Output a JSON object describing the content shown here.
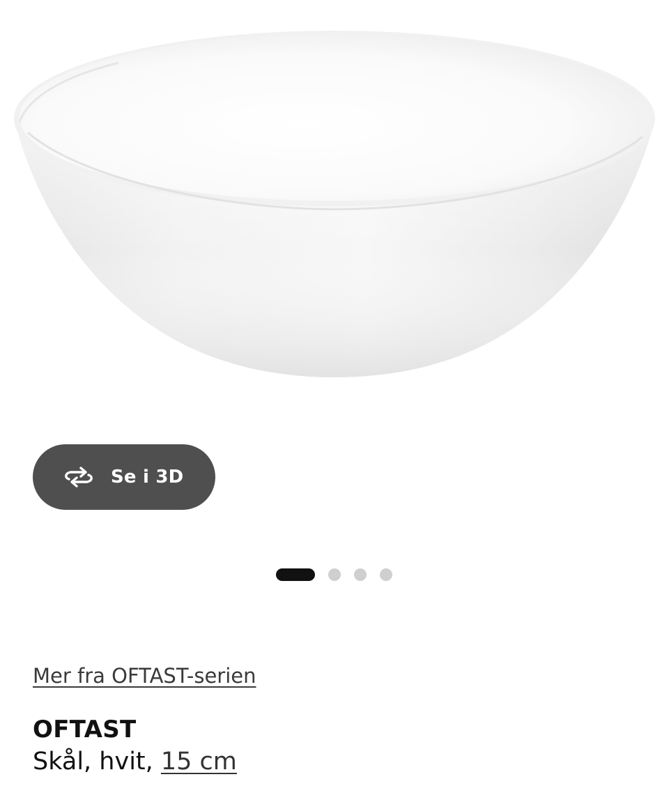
{
  "product_image": {
    "alt_icon": "bowl-image"
  },
  "view_3d": {
    "label": "Se i 3D",
    "icon": "rotate-3d-icon",
    "background": "#4f4f4f"
  },
  "carousel": {
    "total": 4,
    "active_index": 1,
    "active_color": "#111111",
    "inactive_color": "#cfcfcf"
  },
  "series_link": {
    "label": "Mer fra OFTAST-serien"
  },
  "product": {
    "name": "OFTAST",
    "description_prefix": "Skål, hvit, ",
    "size": "15 cm"
  }
}
